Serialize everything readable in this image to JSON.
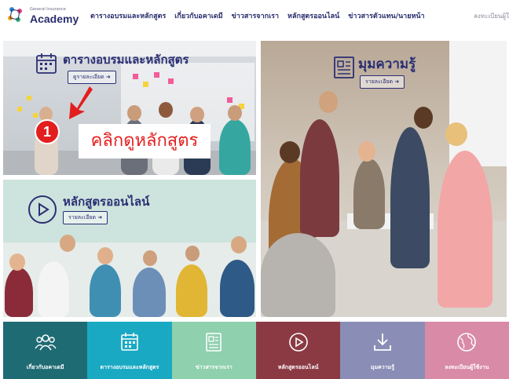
{
  "header": {
    "logo_small": "General Insurance",
    "logo_text": "Academy",
    "nav": [
      "ตารางอบรมและหลักสูตร",
      "เกี่ยวกับอคาเดมี",
      "ข่าวสารจากเรา",
      "หลักสูตรออนไลน์",
      "ข่าวสารตัวแทน/นายหน้า"
    ],
    "nav_right": "ลงทะเบียนผู้ใช้งาน"
  },
  "tiles": {
    "schedule": {
      "title": "ตารางอบรมและหลักสูตร",
      "button": "ดูรายละเอียด"
    },
    "online": {
      "title": "หลักสูตรออนไลน์",
      "button": "รายละเอียด"
    },
    "article": {
      "title": "มุมความรู้",
      "button": "รายละเอียด"
    }
  },
  "callout": {
    "step": "1",
    "text": "คลิกดูหลักสูตร",
    "color": "#e31e1e"
  },
  "bottom": [
    {
      "label": "เกี่ยวกับอคาเดมี",
      "color": "#1f6b74",
      "icon": "group-icon"
    },
    {
      "label": "ตารางอบรมและหลักสูตร",
      "color": "#1aa9c3",
      "icon": "calendar-icon"
    },
    {
      "label": "ข่าวสารจากเรา",
      "color": "#8fd0ae",
      "icon": "news-icon"
    },
    {
      "label": "หลักสูตรออนไลน์",
      "color": "#8b3a44",
      "icon": "play-icon"
    },
    {
      "label": "มุมความรู้",
      "color": "#8a8eb6",
      "icon": "download-icon"
    },
    {
      "label": "ลงทะเบียนผู้ใช้งาน",
      "color": "#d98aa6",
      "icon": "globe-icon"
    }
  ]
}
